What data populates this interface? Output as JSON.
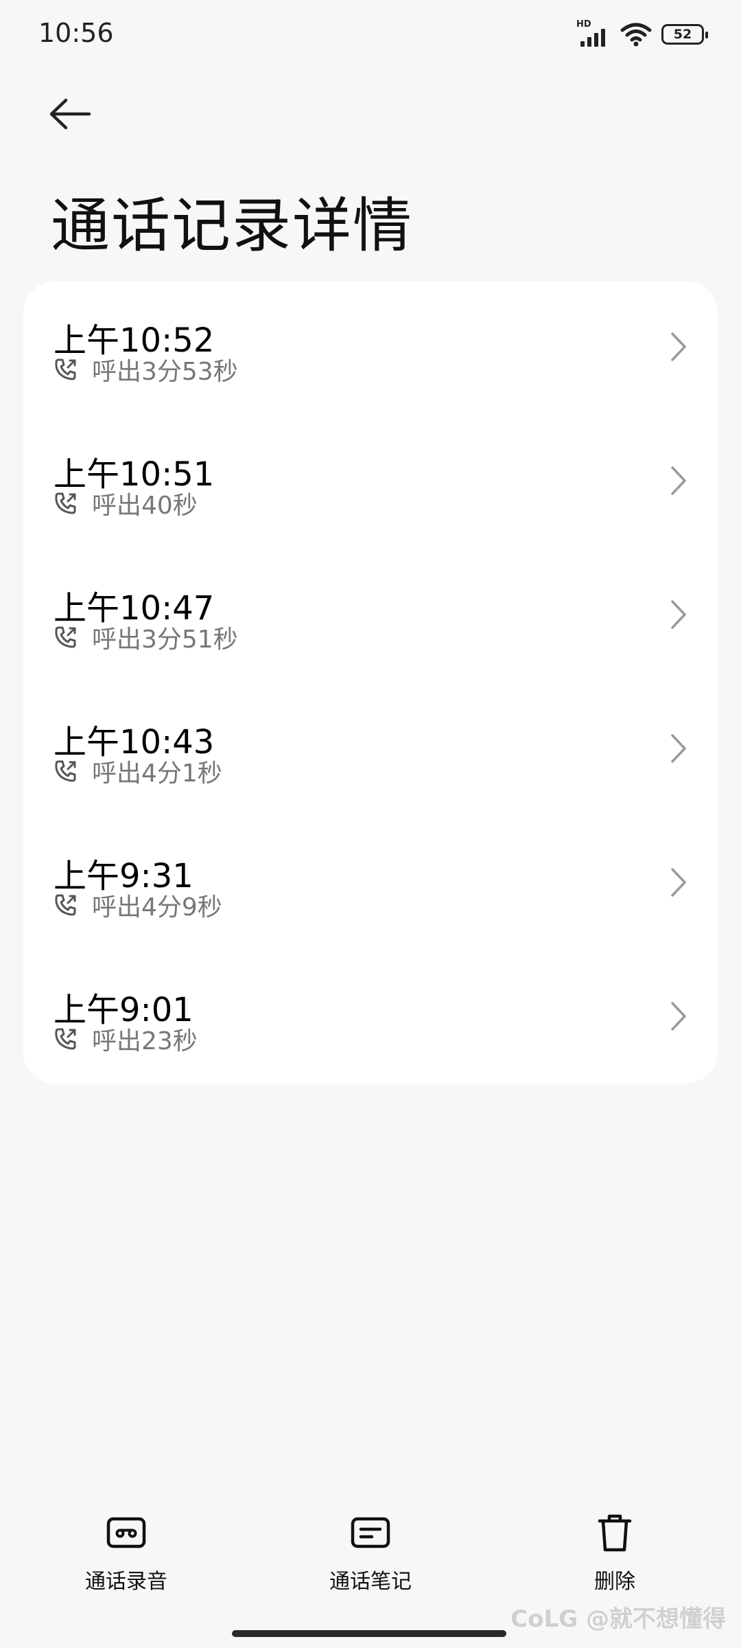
{
  "status_bar": {
    "time": "10:56",
    "network_label": "HD",
    "battery_level": "52"
  },
  "header": {
    "title": "通话记录详情"
  },
  "calls": [
    {
      "time": "上午10:52",
      "duration": "呼出3分53秒"
    },
    {
      "time": "上午10:51",
      "duration": "呼出40秒"
    },
    {
      "time": "上午10:47",
      "duration": "呼出3分51秒"
    },
    {
      "time": "上午10:43",
      "duration": "呼出4分1秒"
    },
    {
      "time": "上午9:31",
      "duration": "呼出4分9秒"
    },
    {
      "time": "上午9:01",
      "duration": "呼出23秒"
    }
  ],
  "toolbar": {
    "recording_label": "通话录音",
    "notes_label": "通话笔记",
    "delete_label": "删除"
  },
  "watermark": "CoLG @就不想懂得"
}
